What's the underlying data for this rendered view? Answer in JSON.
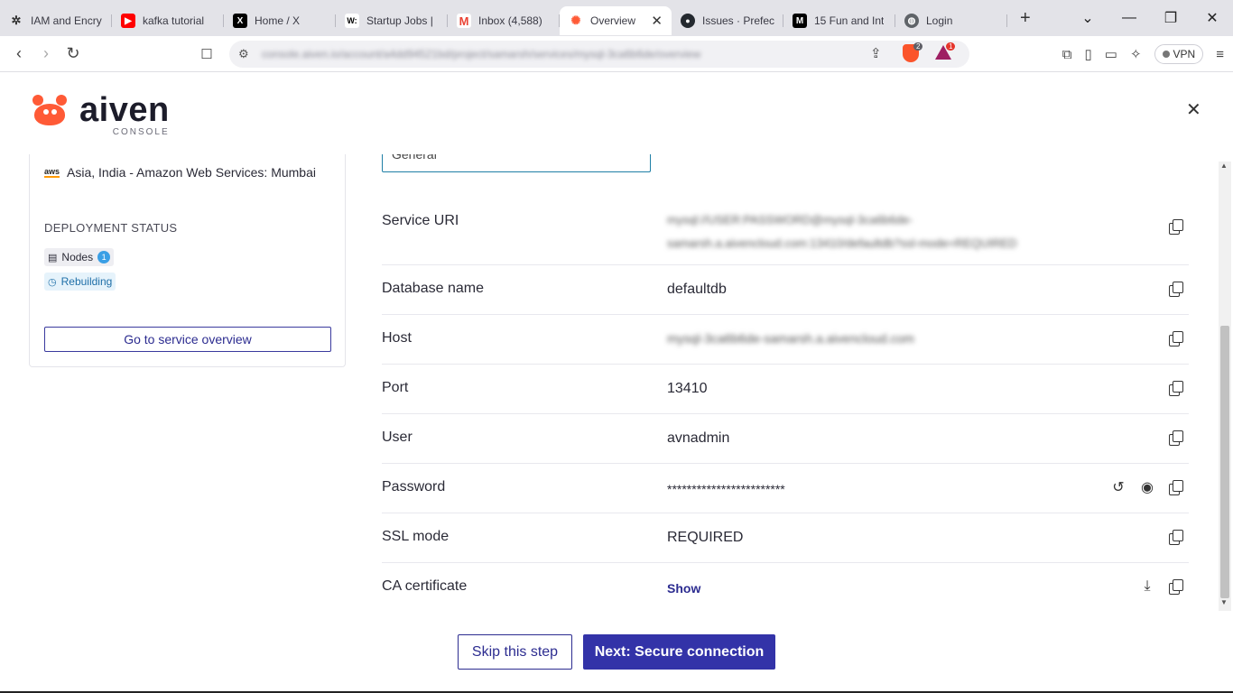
{
  "browser": {
    "tabs": [
      {
        "label": "IAM and Encry",
        "icon": "openai-icon",
        "color": "#333333"
      },
      {
        "label": "kafka tutorial",
        "icon": "youtube-icon",
        "color": "#ff0000"
      },
      {
        "label": "Home / X",
        "icon": "x-icon",
        "color": "#000000"
      },
      {
        "label": "Startup Jobs |",
        "icon": "wellfound-icon",
        "color": "#000000"
      },
      {
        "label": "Inbox (4,588)",
        "icon": "gmail-icon",
        "color": "#ea4335"
      },
      {
        "label": "Overview",
        "icon": "aiven-icon",
        "color": "#ff5a36",
        "active": true
      },
      {
        "label": "Issues · Prefec",
        "icon": "github-icon",
        "color": "#24292f"
      },
      {
        "label": "15 Fun and Int",
        "icon": "medium-icon",
        "color": "#000000"
      },
      {
        "label": "Login",
        "icon": "globe-icon",
        "color": "#5f6368"
      }
    ],
    "url": "console.aiven.io/account/a4dd94521bd/project/samarsh/services/mysql-3ca6b6de/overview",
    "brave_badge": "2",
    "rewards_badge": "1",
    "vpn_label": "VPN"
  },
  "header": {
    "logo_word": "aiven",
    "logo_sub": "CONSOLE"
  },
  "left_card": {
    "region_provider": "aws",
    "region": "Asia, India - Amazon Web Services: Mumbai",
    "deployment_heading": "DEPLOYMENT STATUS",
    "nodes_label": "Nodes",
    "nodes_count": "1",
    "status_label": "Rebuilding",
    "overview_button": "Go to service overview"
  },
  "connection": {
    "general_label": "General",
    "rows": [
      {
        "label": "Service URI",
        "value": "mysql://USER:PASSWORD@mysql-3ca6b6de-samarsh.a.aivencloud.com:13410/defaultdb?ssl-mode=REQUIRED",
        "blurred": true
      },
      {
        "label": "Database name",
        "value": "defaultdb"
      },
      {
        "label": "Host",
        "value": "mysql-3ca6b6de-samarsh.a.aivencloud.com",
        "blurred": true
      },
      {
        "label": "Port",
        "value": "13410"
      },
      {
        "label": "User",
        "value": "avnadmin"
      },
      {
        "label": "Password",
        "value": "************************"
      },
      {
        "label": "SSL mode",
        "value": "REQUIRED"
      },
      {
        "label": "CA certificate",
        "value": "Show"
      }
    ]
  },
  "footer": {
    "skip_label": "Skip this step",
    "next_label": "Next: Secure connection"
  },
  "colors": {
    "brand_accent": "#ff5a36",
    "primary_button": "#3333a8",
    "link": "#2c2c90"
  }
}
